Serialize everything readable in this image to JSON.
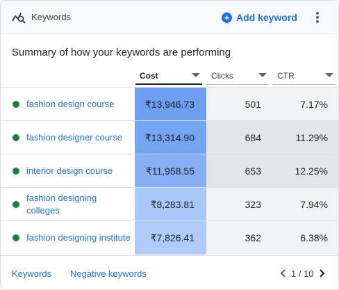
{
  "header": {
    "title": "Keywords",
    "add_label": "Add keyword"
  },
  "summary": "Summary of how your keywords are performing",
  "columns": {
    "cost": "Cost",
    "clicks": "Clicks",
    "ctr": "CTR"
  },
  "rows": [
    {
      "keyword": "fashion design course",
      "cost": "₹13,946.73",
      "clicks": "501",
      "ctr": "7.17%",
      "cost_color": "#6e9ff2"
    },
    {
      "keyword": "fashion designer course",
      "cost": "₹13,314.90",
      "clicks": "684",
      "ctr": "11.29%",
      "cost_color": "#75a4f3"
    },
    {
      "keyword": "interior design course",
      "cost": "₹11,958.55",
      "clicks": "653",
      "ctr": "12.25%",
      "cost_color": "#86aff5"
    },
    {
      "keyword": "fashion designing colleges",
      "cost": "₹8,283.81",
      "clicks": "323",
      "ctr": "7.94%",
      "cost_color": "#a9c7f8"
    },
    {
      "keyword": "fashion designing institute",
      "cost": "₹7,826.41",
      "clicks": "362",
      "ctr": "6.38%",
      "cost_color": "#afcbf9"
    }
  ],
  "footer": {
    "keywords_link": "Keywords",
    "negative_link": "Negative keywords",
    "pagination": "1 / 10"
  },
  "colors": {
    "accent": "#1a73e8",
    "status_enabled": "#188038"
  }
}
